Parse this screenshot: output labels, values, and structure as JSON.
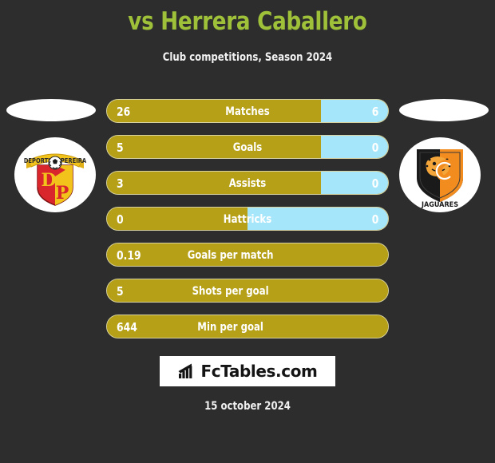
{
  "header": {
    "title": "vs Herrera Caballero",
    "subtitle": "Club competitions, Season 2024",
    "title_color": "#9fc13a"
  },
  "teams": {
    "left": {
      "name": "Deportivo Pereira",
      "banner_text": "DEPORTIVO PEREIRA",
      "initials_top": "D",
      "initials_bottom": "P",
      "colors": {
        "primary": "#d9262c",
        "secondary": "#f2c31b"
      }
    },
    "right": {
      "name": "Jaguares",
      "banner_text": "JAGUARES",
      "monogram": "C",
      "colors": {
        "primary": "#1a1a1a",
        "secondary": "#f28c1e"
      }
    }
  },
  "colors": {
    "background": "#2d2d2d",
    "bar_left": "#b5a017",
    "bar_right": "#a6e6fb",
    "bar_border": "#d8d2a0",
    "value_text": "#ffffff"
  },
  "chart_data": {
    "type": "bar",
    "title": "vs Herrera Caballero",
    "subtitle": "Club competitions, Season 2024",
    "orientation": "horizontal-diverging",
    "series": [
      {
        "name": "Deportivo Pereira",
        "color": "#b5a017"
      },
      {
        "name": "Jaguares",
        "color": "#a6e6fb"
      }
    ],
    "categories": [
      "Matches",
      "Goals",
      "Assists",
      "Hattricks",
      "Goals per match",
      "Shots per goal",
      "Min per goal"
    ],
    "rows": [
      {
        "label": "Matches",
        "left_value": "26",
        "right_value": "6",
        "left_pct": 76,
        "has_right": true
      },
      {
        "label": "Goals",
        "left_value": "5",
        "right_value": "0",
        "left_pct": 76,
        "has_right": true
      },
      {
        "label": "Assists",
        "left_value": "3",
        "right_value": "0",
        "left_pct": 76,
        "has_right": true
      },
      {
        "label": "Hattricks",
        "left_value": "0",
        "right_value": "0",
        "left_pct": 50,
        "has_right": true
      },
      {
        "label": "Goals per match",
        "left_value": "0.19",
        "right_value": "",
        "left_pct": 100,
        "has_right": false
      },
      {
        "label": "Shots per goal",
        "left_value": "5",
        "right_value": "",
        "left_pct": 100,
        "has_right": false
      },
      {
        "label": "Min per goal",
        "left_value": "644",
        "right_value": "",
        "left_pct": 100,
        "has_right": false
      }
    ]
  },
  "footer": {
    "brand": "FcTables.com",
    "brand_icon": "bar-chart-icon",
    "date": "15 october 2024"
  }
}
